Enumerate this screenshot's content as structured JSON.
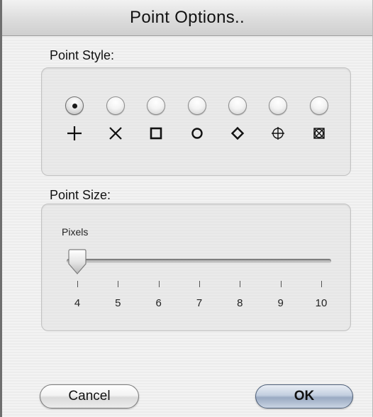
{
  "window": {
    "title": "Point Options.."
  },
  "point_style": {
    "label": "Point Style:",
    "selected_index": 0,
    "options": [
      {
        "symbol_icon": "plus-icon"
      },
      {
        "symbol_icon": "x-icon"
      },
      {
        "symbol_icon": "square-icon"
      },
      {
        "symbol_icon": "circle-icon"
      },
      {
        "symbol_icon": "diamond-icon"
      },
      {
        "symbol_icon": "circled-plus-icon"
      },
      {
        "symbol_icon": "boxed-x-circle-icon"
      }
    ]
  },
  "point_size": {
    "label": "Point Size:",
    "slider_label": "Pixels",
    "value": 4,
    "min": 4,
    "max": 10,
    "ticks": [
      "4",
      "5",
      "6",
      "7",
      "8",
      "9",
      "10"
    ]
  },
  "buttons": {
    "cancel_label": "Cancel",
    "ok_label": "OK"
  }
}
